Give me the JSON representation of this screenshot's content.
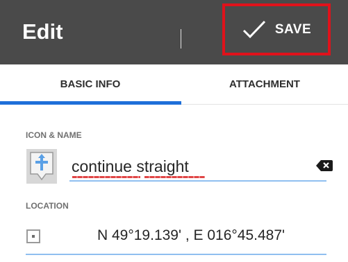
{
  "toolbar": {
    "title": "Edit",
    "save_label": "SAVE",
    "save_icon": "check-icon",
    "highlight_color": "#e0121b",
    "background": "#4a4a4a"
  },
  "tabs": [
    {
      "label": "BASIC INFO",
      "selected": true
    },
    {
      "label": "ATTACHMENT",
      "selected": false
    }
  ],
  "accent_color": "#1e6fd9",
  "form": {
    "icon_name_label": "ICON & NAME",
    "point_icon": "waypoint-turn-straight-icon",
    "name_value": "continue straight",
    "clear_icon": "backspace-clear-icon",
    "location_label": "LOCATION",
    "location_icon": "location-square-icon",
    "location_value": "N 49°19.139' , E 016°45.487'"
  }
}
